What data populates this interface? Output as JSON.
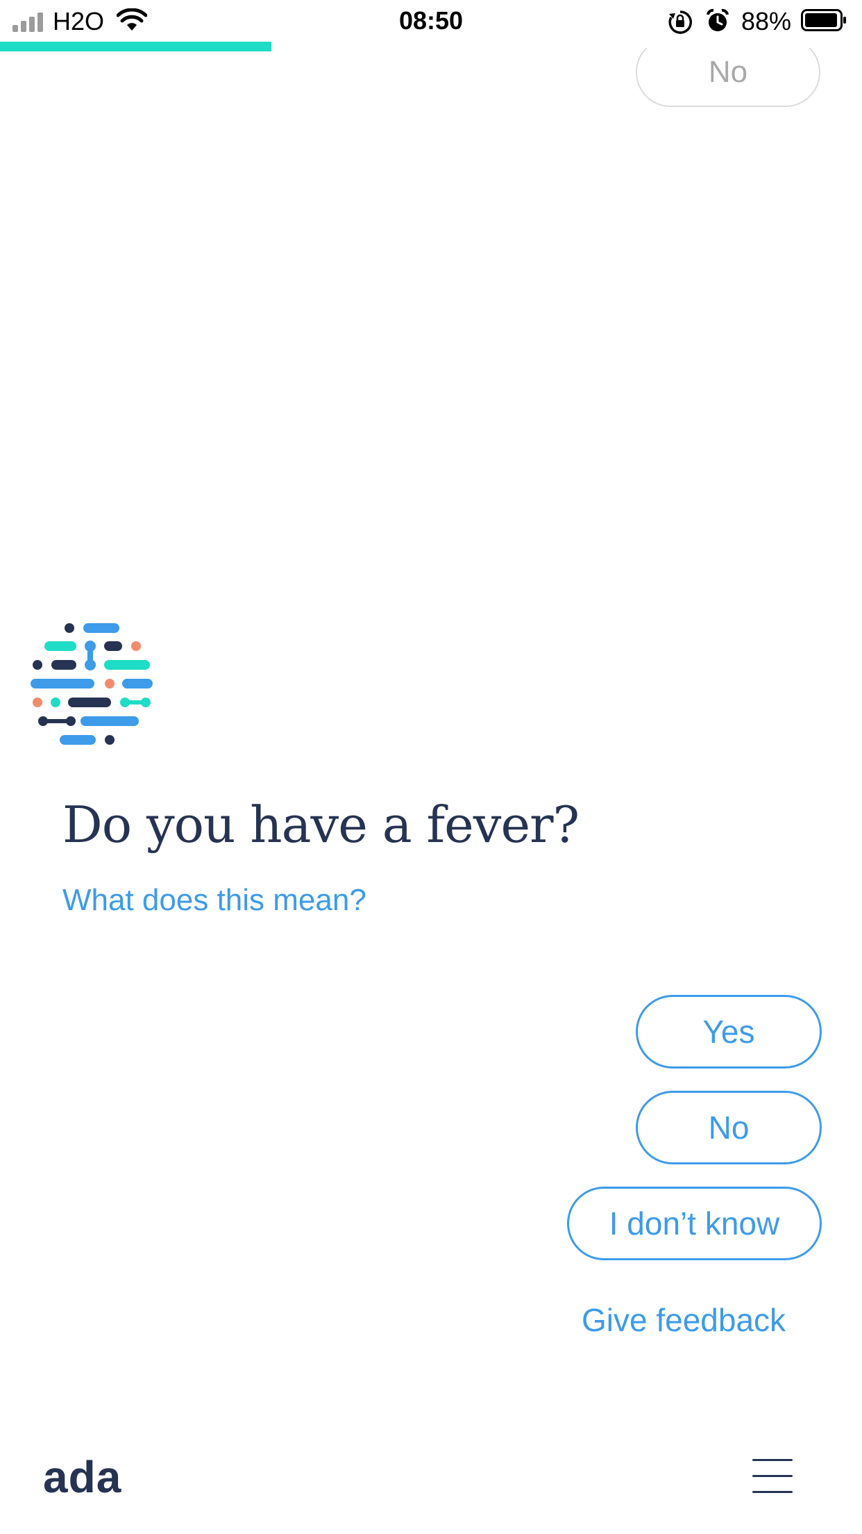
{
  "status_bar": {
    "carrier": "H2O",
    "time": "08:50",
    "battery_percent": "88%",
    "icons": [
      "signal-icon",
      "wifi-icon",
      "rotation-lock-icon",
      "alarm-icon",
      "battery-icon"
    ]
  },
  "progress": {
    "fraction": 0.315,
    "color": "#1fdcc6"
  },
  "previous_answer": {
    "label": "No"
  },
  "question": {
    "text": "Do you have a fever?",
    "help_link": "What does this mean?"
  },
  "answers": {
    "yes": "Yes",
    "no": "No",
    "dont_know": "I don’t know"
  },
  "feedback_link": "Give feedback",
  "footer": {
    "brand": "ada",
    "menu_icon": "hamburger-menu-icon"
  },
  "colors": {
    "accent": "#3d9be9",
    "navy": "#263352",
    "teal": "#1fdcc6",
    "coral": "#f28b6c"
  }
}
